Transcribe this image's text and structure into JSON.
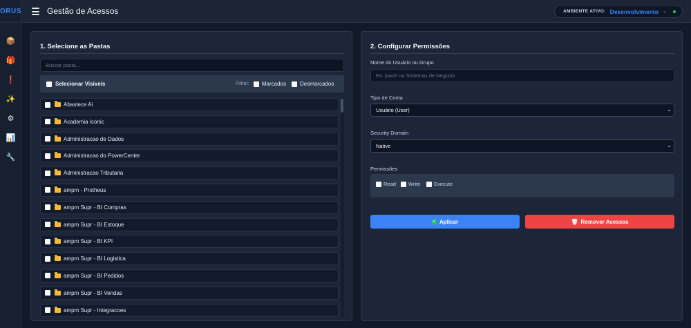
{
  "app": {
    "logo": "ORUS"
  },
  "sidebar": {
    "icons": [
      {
        "name": "box-icon",
        "glyph": "📦"
      },
      {
        "name": "gift-icon",
        "glyph": "🎁"
      },
      {
        "name": "alert-icon",
        "glyph": "❗"
      },
      {
        "name": "sparkle-icon",
        "glyph": "✨"
      },
      {
        "name": "gear-icon",
        "glyph": "⚙"
      },
      {
        "name": "chart-icon",
        "glyph": "📊"
      },
      {
        "name": "wrench-icon",
        "glyph": "🔧"
      }
    ]
  },
  "header": {
    "title": "Gestão de Acessos",
    "env_label": "AMBIENTE ATIVO:",
    "env_value": "Desenvolvimento",
    "env_status_color": "#22c55e"
  },
  "left_panel": {
    "title": "1. Selecione as Pastas",
    "search_placeholder": "Buscar pasta...",
    "select_all_label": "Selecionar Visíveis",
    "filter_label": "Filtrar:",
    "filter_marked": "Marcados",
    "filter_unmarked": "Desmarcados",
    "folders": [
      "Abastece Ai",
      "Academia Iconic",
      "Administracao de Dados",
      "Administracao do PowerCenter",
      "Administracao Tributaria",
      "ampm - Protheus",
      "ampm Supr - BI Compras",
      "ampm Supr - BI Estoque",
      "ampm Supr - BI KPI",
      "ampm Supr - BI Logistica",
      "ampm Supr - BI Pedidos",
      "ampm Supr - BI Vendas",
      "ampm Supr - Integracoes"
    ]
  },
  "right_panel": {
    "title": "2. Configurar Permissões",
    "user_label": "Nome do Usuário ou Grupo",
    "user_placeholder": "Ex: joaoh ou Sistemas de Negocio",
    "account_type_label": "Tipo de Conta",
    "account_type_value": "Usuário (User)",
    "security_domain_label": "Security Domain",
    "security_domain_value": "Native",
    "permissions_label": "Permissões",
    "perm_read": "Read",
    "perm_write": "Write",
    "perm_execute": "Execute",
    "apply_label": "Aplicar",
    "remove_label": "Remover Acessos"
  },
  "colors": {
    "accent": "#3b82f6",
    "danger": "#ef4444",
    "folder": "#f5b938"
  }
}
